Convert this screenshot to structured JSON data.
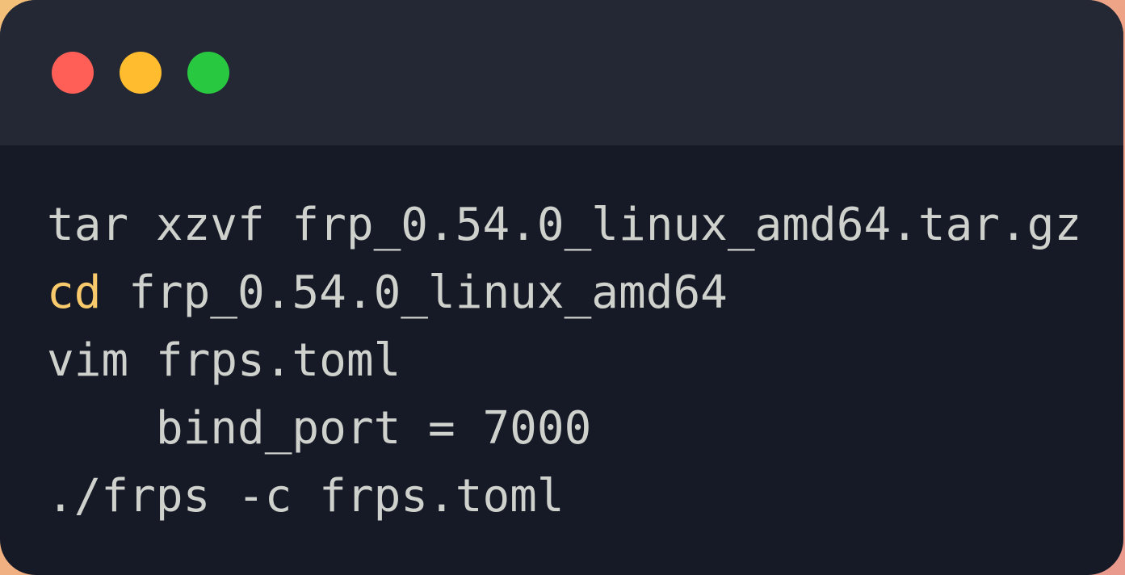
{
  "colors": {
    "close": "#ff5f57",
    "minimize": "#febc2e",
    "maximize": "#28c840",
    "text": "#cfd1cc",
    "keyword": "#f9ca6c"
  },
  "window_controls": {
    "close": "close-button",
    "minimize": "minimize-button",
    "maximize": "maximize-button"
  },
  "code": {
    "lines": [
      {
        "kw": "",
        "rest": "tar xzvf frp_0.54.0_linux_amd64.tar.gz"
      },
      {
        "kw": "cd",
        "rest": " frp_0.54.0_linux_amd64"
      },
      {
        "kw": "",
        "rest": "vim frps.toml"
      },
      {
        "kw": "",
        "rest": "    bind_port = 7000"
      },
      {
        "kw": "",
        "rest": "./frps -c frps.toml"
      }
    ]
  }
}
